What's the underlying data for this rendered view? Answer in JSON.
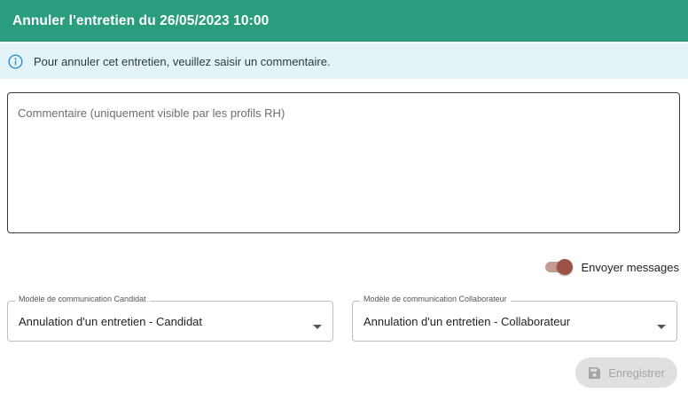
{
  "dialog": {
    "title": "Annuler l'entretien du 26/05/2023 10:00"
  },
  "info_banner": {
    "icon": "info-icon",
    "text": "Pour annuler cet entretien, veuillez saisir un commentaire."
  },
  "comment": {
    "placeholder": "Commentaire (uniquement visible par les profils RH)",
    "value": ""
  },
  "send_messages": {
    "label": "Envoyer messages",
    "enabled": true
  },
  "templates": {
    "candidate": {
      "label": "Modèle de communication Candidat",
      "value": "Annulation d'un entretien - Candidat"
    },
    "collaborator": {
      "label": "Modèle de communication Collaborateur",
      "value": "Annulation d'un entretien - Collaborateur"
    }
  },
  "actions": {
    "save_label": "Enregistrer",
    "save_icon": "floppy-disk-icon",
    "save_disabled": true
  },
  "colors": {
    "header": "#2a9d7e",
    "banner": "#e3f3f7",
    "info_icon": "#2c8fd1",
    "toggle_knob": "#9c5147",
    "toggle_track": "#c79a93"
  }
}
